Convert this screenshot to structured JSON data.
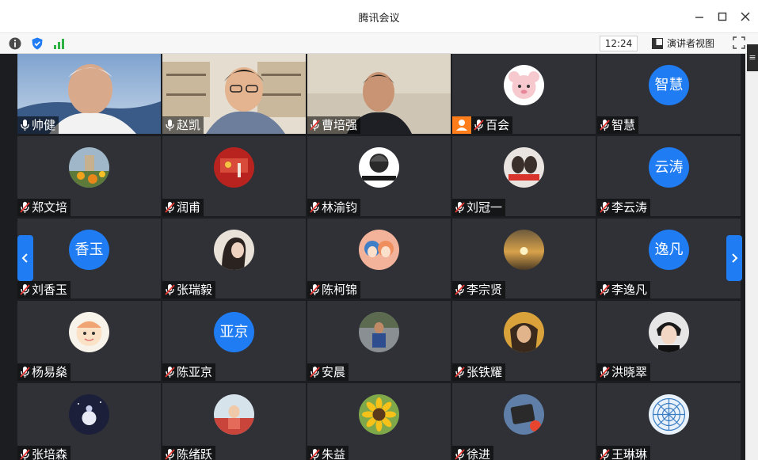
{
  "window": {
    "title": "腾讯会议"
  },
  "toolbar": {
    "time": "12:24",
    "presenter_view_label": "演讲者视图"
  },
  "colors": {
    "accent": "#1f7cf3",
    "host_badge": "#ff7d1a",
    "muted_mic": "#e53935"
  },
  "participants": [
    {
      "name": "帅健",
      "type": "video",
      "mic": "on"
    },
    {
      "name": "赵凯",
      "type": "video",
      "mic": "on"
    },
    {
      "name": "曹培强",
      "type": "video",
      "mic": "muted"
    },
    {
      "name": "百会",
      "type": "avatar-image",
      "mic": "muted",
      "host": true
    },
    {
      "name": "智慧",
      "type": "avatar-text",
      "avatar_text": "智慧",
      "mic": "muted"
    },
    {
      "name": "郑文培",
      "type": "avatar-image",
      "mic": "muted"
    },
    {
      "name": "润甫",
      "type": "avatar-image",
      "mic": "muted"
    },
    {
      "name": "林渝钧",
      "type": "avatar-image",
      "mic": "muted"
    },
    {
      "name": "刘冠一",
      "type": "avatar-image",
      "mic": "muted"
    },
    {
      "name": "李云涛",
      "type": "avatar-text",
      "avatar_text": "云涛",
      "mic": "muted"
    },
    {
      "name": "刘香玉",
      "type": "avatar-text",
      "avatar_text": "香玉",
      "mic": "muted"
    },
    {
      "name": "张瑞毅",
      "type": "avatar-image",
      "mic": "muted"
    },
    {
      "name": "陈柯锦",
      "type": "avatar-image",
      "mic": "muted"
    },
    {
      "name": "李宗贤",
      "type": "avatar-image",
      "mic": "muted"
    },
    {
      "name": "李逸凡",
      "type": "avatar-text",
      "avatar_text": "逸凡",
      "mic": "muted"
    },
    {
      "name": "杨易燊",
      "type": "avatar-image",
      "mic": "muted"
    },
    {
      "name": "陈亚京",
      "type": "avatar-text",
      "avatar_text": "亚京",
      "mic": "muted"
    },
    {
      "name": "安晨",
      "type": "avatar-image",
      "mic": "muted"
    },
    {
      "name": "张铁耀",
      "type": "avatar-image",
      "mic": "muted"
    },
    {
      "name": "洪晓翠",
      "type": "avatar-image",
      "mic": "muted"
    },
    {
      "name": "张培森",
      "type": "avatar-image",
      "mic": "muted"
    },
    {
      "name": "陈绪跃",
      "type": "avatar-image",
      "mic": "muted"
    },
    {
      "name": "朱益",
      "type": "avatar-image",
      "mic": "muted"
    },
    {
      "name": "徐进",
      "type": "avatar-image",
      "mic": "muted"
    },
    {
      "name": "王琳琳",
      "type": "avatar-image",
      "mic": "muted"
    }
  ]
}
